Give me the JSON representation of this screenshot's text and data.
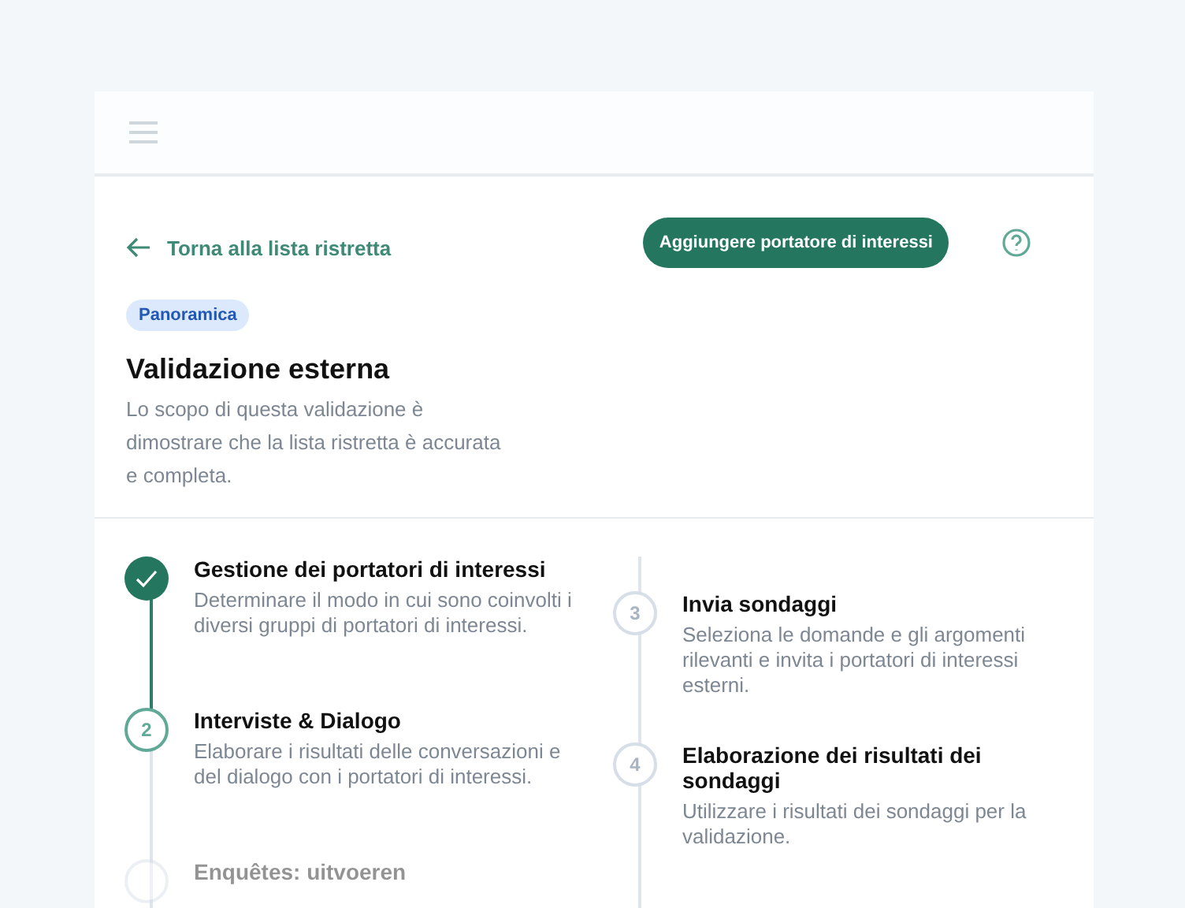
{
  "back_link": "Torna alla lista ristretta",
  "add_button": "Aggiungere portatore di interessi",
  "badge": "Panoramica",
  "title": "Validazione esterna",
  "description": "Lo scopo di questa validazione è dimostrare che la lista ristretta è accurata e completa.",
  "columns": [
    {
      "steps": [
        {
          "done": true,
          "current": false,
          "faded": false,
          "title": "Gestione dei portatori di interessi",
          "description": "Determinare il modo in cui sono coinvolti i diversi gruppi di portatori di interessi."
        },
        {
          "number": "2",
          "done": false,
          "current": true,
          "faded": false,
          "title": "Interviste & Dialogo",
          "description": "Elaborare i risultati delle conversazioni e del dialogo con i portatori di interessi."
        },
        {
          "done": false,
          "current": false,
          "faded": true,
          "title": "Enquêtes: uitvoeren"
        }
      ]
    },
    {
      "steps": [
        {
          "number": "3",
          "done": false,
          "current": false,
          "faded": false,
          "title": "Invia sondaggi",
          "description": "Seleziona le domande e gli argomenti rilevanti e invita i portatori di interessi esterni."
        },
        {
          "number": "4",
          "done": false,
          "current": false,
          "faded": false,
          "title": "Elaborazione dei risultati dei sondaggi",
          "description": "Utilizzare i risultati dei sondaggi per la validazione."
        }
      ]
    }
  ]
}
